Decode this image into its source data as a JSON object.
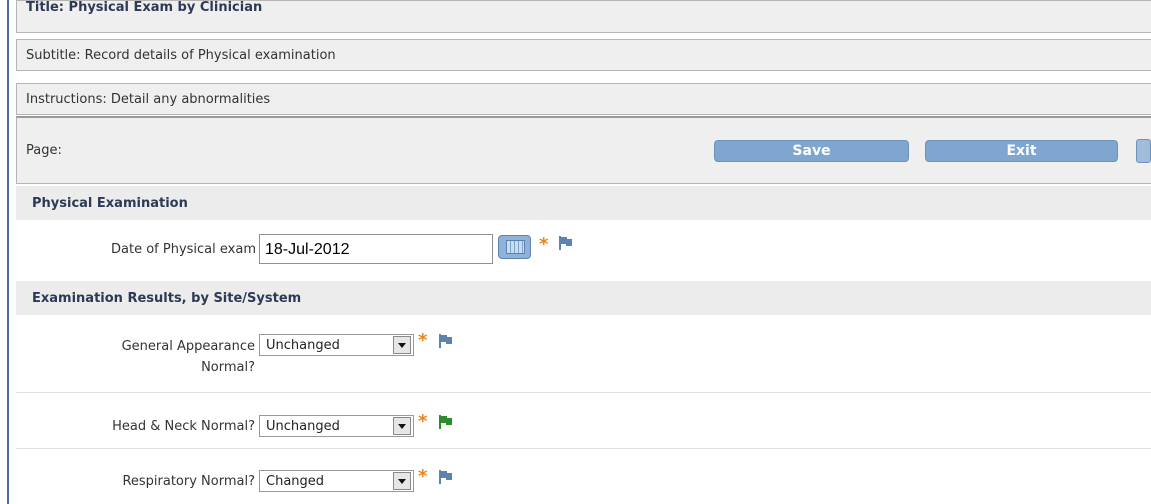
{
  "form": {
    "title": "Title: Physical Exam by Clinician",
    "subtitle": "Subtitle: Record details of Physical examination",
    "instructions": "Instructions: Detail any abnormalities",
    "page_label": "Page:"
  },
  "toolbar": {
    "save_label": "Save",
    "exit_label": "Exit"
  },
  "sections": {
    "physical_exam": {
      "heading": "Physical Examination",
      "date_label": "Date of Physical exam",
      "date_value": "18-Jul-2012"
    },
    "results": {
      "heading": "Examination Results, by Site/System",
      "fields": [
        {
          "label_line1": "General Appearance",
          "label_line2": "Normal?",
          "value": "Unchanged",
          "flag_color": "blue"
        },
        {
          "label": "Head & Neck Normal?",
          "value": "Unchanged",
          "flag_color": "green"
        },
        {
          "label": "Respiratory Normal?",
          "value": "Changed",
          "flag_color": "blue"
        }
      ]
    }
  },
  "colors": {
    "required_asterisk": "#e8851c",
    "button_bg": "#7fa6cf",
    "flag_blue": "#5d84b0",
    "flag_green": "#2e8b2e"
  },
  "icons": {
    "calendar": "calendar-icon",
    "flag": "flag-icon"
  }
}
